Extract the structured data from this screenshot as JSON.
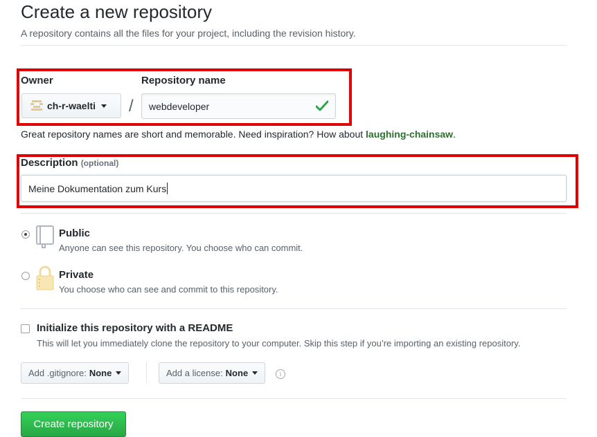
{
  "header": {
    "title": "Create a new repository",
    "subtitle": "A repository contains all the files for your project, including the revision history."
  },
  "owner": {
    "label": "Owner",
    "value": "ch-r-waelti"
  },
  "separator": "/",
  "repo": {
    "label": "Repository name",
    "value": "webdeveloper",
    "valid_icon": "check-icon"
  },
  "hint": {
    "text": "Great repository names are short and memorable. Need inspiration? How about",
    "suggestion": "laughing-chainsaw",
    "end": "."
  },
  "description": {
    "label": "Description",
    "optional": "(optional)",
    "value": "Meine Dokumentation zum Kurs"
  },
  "visibility": {
    "selected": "public",
    "options": [
      {
        "id": "public",
        "title": "Public",
        "desc": "Anyone can see this repository. You choose who can commit.",
        "icon": "repo-book-icon"
      },
      {
        "id": "private",
        "title": "Private",
        "desc": "You choose who can see and commit to this repository.",
        "icon": "lock-icon"
      }
    ]
  },
  "readme": {
    "label": "Initialize this repository with a README",
    "desc": "This will let you immediately clone the repository to your computer. Skip this step if you’re importing an existing repository.",
    "checked": false
  },
  "gitignore": {
    "label": "Add .gitignore:",
    "value": "None"
  },
  "license": {
    "label": "Add a license:",
    "value": "None"
  },
  "info_glyph": "i",
  "create_button": "Create repository",
  "colors": {
    "highlight": "#e00000",
    "success": "#28a745",
    "suggestion": "#2c6e2f"
  }
}
